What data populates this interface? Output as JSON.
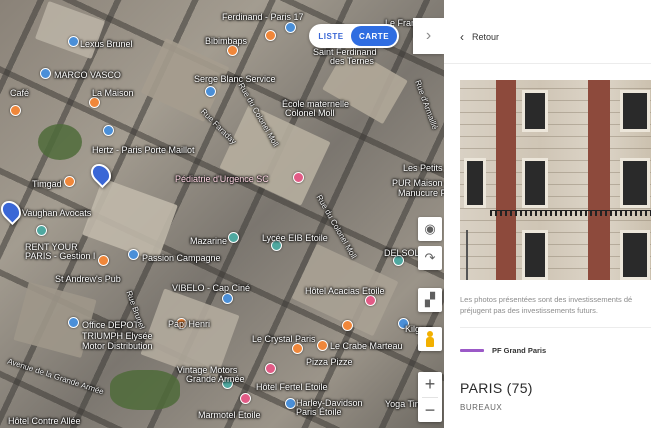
{
  "map": {
    "toggle": {
      "liste": "LISTE",
      "carte": "CARTE"
    },
    "collapse_icon": "chevron-right-icon",
    "labels": [
      "Ferdinand - Paris 17",
      "Le France",
      "Lexus Brunel",
      "Bibimbaps",
      "Saint Ferdinand",
      "des Ternes",
      "MARCO VASCO",
      "La Maison",
      "Café",
      "Serge Blanc Service",
      "École maternelle",
      "Colonel Moll",
      "Hertz - Paris Porte Maillot",
      "Pédiatrie d'Urgence SC",
      "Les Petits B",
      "PUR Maison de",
      "Manucure Fe",
      "Timgad",
      "Vaughan Avocats",
      "Mazarine",
      "Lycée EIB Etoile",
      "RENT YOUR",
      "PARIS - Gestion I",
      "Passion Campagne",
      "DELSOL",
      "St Andrew's Pub",
      "VIBELO - Cap Ciné",
      "Hôtel Acacias Etoile",
      "Papi Henri",
      "Office DEPOT",
      "TRIUMPH Elysée",
      "Motor Distribution",
      "Le Crystal Paris",
      "Le Crabe Marteau",
      "Kilgore",
      "Pizza Pizze",
      "Vintage Motors",
      "Grande Armée",
      "Hôtel Fertel Etoile",
      "Harley-Davidson",
      "Paris Étoile",
      "Yoga Tim",
      "Marmotel Etoile",
      "Hôtel Contre Allée"
    ],
    "streets": [
      "Rue Faraday",
      "Rue du Colonel Moll",
      "Rue du Colonel Moll",
      "Rue Brunel",
      "Avenue de la Grande Armée",
      "Rue d'Armaillé"
    ],
    "controls": {
      "locate_icon": "target-icon",
      "rotate_icon": "rotate-icon",
      "tilt_icon": "tilt-3d-icon",
      "pegman_icon": "pegman-icon",
      "zoom_in": "+",
      "zoom_out": "−"
    }
  },
  "panel": {
    "back_label": "Retour",
    "caption": "Les photos présentées sont des investissements dé préjugent pas des investissements futurs.",
    "fund_name": "PF Grand Paris",
    "fund_color": "#9b59c7",
    "city": "PARIS (75)",
    "asset_type": "BUREAUX"
  },
  "colors": {
    "accent": "#2f6de1"
  }
}
